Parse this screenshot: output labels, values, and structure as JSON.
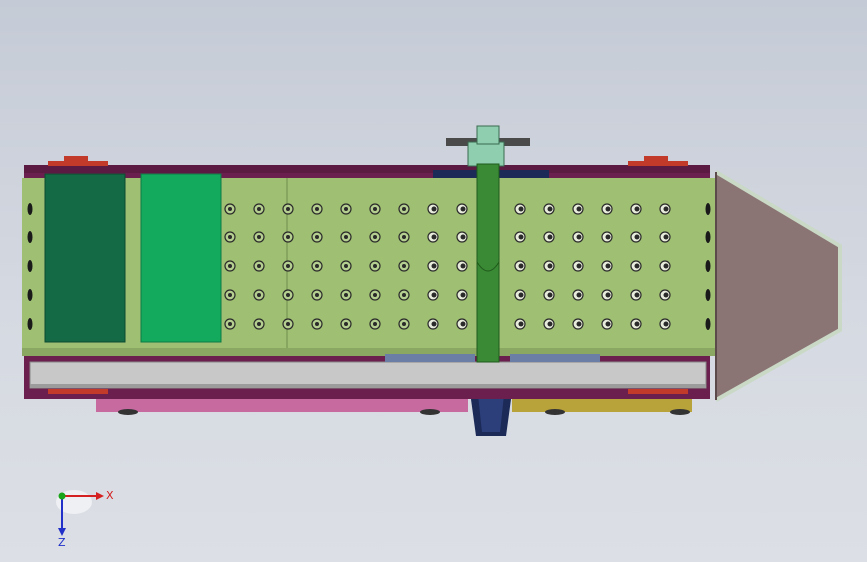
{
  "viewport": {
    "background_top": "#c5cbd6",
    "background_bottom": "#dcdfe5"
  },
  "model": {
    "colors": {
      "frame": "#6b1f4e",
      "body": "#9fbf73",
      "body_dark": "#7e9c57",
      "panel_dark": "#136a45",
      "panel_light": "#13aa5e",
      "shaft": "#3a8a35",
      "shaft_cap": "#8fcfb0",
      "rail": "#c8c8c8",
      "hopper": "#8a7474",
      "hopper_edge": "#c9d9c6",
      "flange_red": "#c23b2a",
      "bottom_pink": "#c76aa0",
      "bottom_yellow": "#b8a23a",
      "dark_blue": "#1b2a57",
      "hole": "#2a2a2a"
    }
  },
  "triad": {
    "x_label": "X",
    "z_label": "Z",
    "x_color": "#d42020",
    "y_color": "#1aa51a",
    "z_color": "#2030c8"
  }
}
